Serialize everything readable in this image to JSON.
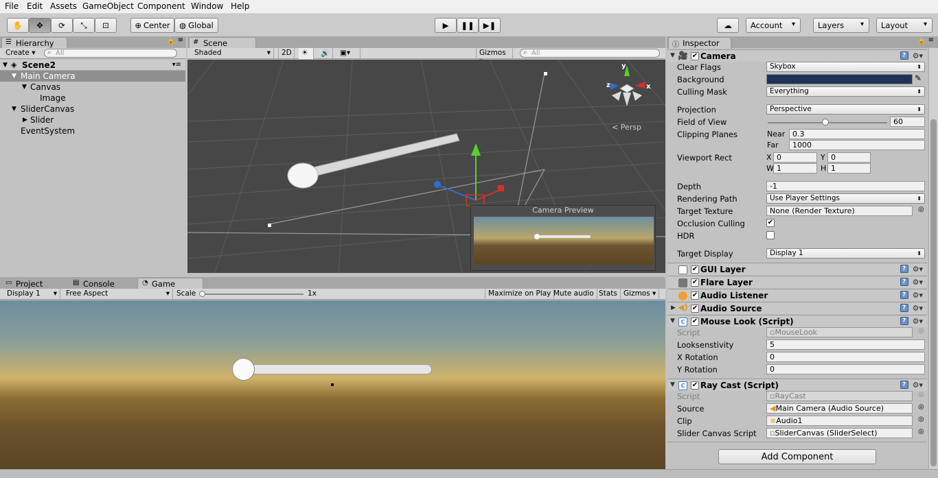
{
  "menu": [
    "File",
    "Edit",
    "Assets",
    "GameObject",
    "Component",
    "Window",
    "Help"
  ],
  "toolbar": {
    "pivot": "Center",
    "space": "Global",
    "account": "Account",
    "layers": "Layers",
    "layout": "Layout"
  },
  "hierarchy": {
    "tab": "Hierarchy",
    "create": "Create",
    "search_placeholder": "All",
    "scene": "Scene2",
    "items": [
      "Main Camera",
      "Canvas",
      "Image",
      "SliderCanvas",
      "Slider",
      "EventSystem"
    ]
  },
  "scene": {
    "tab": "Scene",
    "shading": "Shaded",
    "mode2d": "2D",
    "gizmos": "Gizmos",
    "search_placeholder": "All",
    "persp": "Persp",
    "preview_title": "Camera Preview",
    "axes": {
      "y": "y",
      "z": "z",
      "x": "x"
    }
  },
  "bottom": {
    "tabs": [
      "Project",
      "Console",
      "Game"
    ],
    "display": "Display 1",
    "aspect": "Free Aspect",
    "scale_label": "Scale",
    "scale_value": "1x",
    "buttons": [
      "Maximize on Play",
      "Mute audio",
      "Stats",
      "Gizmos"
    ]
  },
  "inspector": {
    "tab": "Inspector",
    "camera": {
      "title": "Camera",
      "rows": [
        {
          "label": "Clear Flags",
          "value": "Skybox"
        },
        {
          "label": "Background",
          "value": ""
        },
        {
          "label": "Culling Mask",
          "value": "Everything"
        },
        {
          "label": "Projection",
          "value": "Perspective"
        },
        {
          "label": "Field of View",
          "value": "60"
        },
        {
          "label": "Clipping Planes",
          "value": ""
        },
        {
          "label": "Viewport Rect",
          "value": ""
        },
        {
          "label": "Depth",
          "value": "-1"
        },
        {
          "label": "Rendering Path",
          "value": "Use Player Settings"
        },
        {
          "label": "Target Texture",
          "value": "None (Render Texture)"
        },
        {
          "label": "Occlusion Culling",
          "value": ""
        },
        {
          "label": "HDR",
          "value": ""
        },
        {
          "label": "Target Display",
          "value": "Display 1"
        }
      ],
      "fov_fraction": 0.48,
      "near_label": "Near",
      "near": "0.3",
      "far_label": "Far",
      "far": "1000",
      "viewport": {
        "x_label": "X",
        "x": "0",
        "y_label": "Y",
        "y": "0",
        "w_label": "W",
        "w": "1",
        "h_label": "H",
        "h": "1"
      },
      "background_color": "#1f3358"
    },
    "components": [
      "GUI Layer",
      "Flare Layer",
      "Audio Listener",
      "Audio Source",
      "Mouse Look (Script)",
      "Ray Cast (Script)"
    ],
    "mouse_look": {
      "rows": [
        {
          "label": "Script",
          "value": "MouseLook"
        },
        {
          "label": "Looksenstivity",
          "value": "5"
        },
        {
          "label": "X Rotation",
          "value": "0"
        },
        {
          "label": "Y Rotation",
          "value": "0"
        }
      ]
    },
    "ray_cast": {
      "rows": [
        {
          "label": "Script",
          "value": "RayCast"
        },
        {
          "label": "Source",
          "value": "Main Camera (Audio Source)"
        },
        {
          "label": "Clip",
          "value": "Audio1"
        },
        {
          "label": "Slider Canvas Script",
          "value": "SliderCanvas (SliderSelect)"
        }
      ]
    },
    "add_component": "Add Component"
  },
  "colors": {
    "accent_blue": "#2d6fd6",
    "gizmo_green": "#59d12e",
    "gizmo_red": "#d6302a"
  }
}
